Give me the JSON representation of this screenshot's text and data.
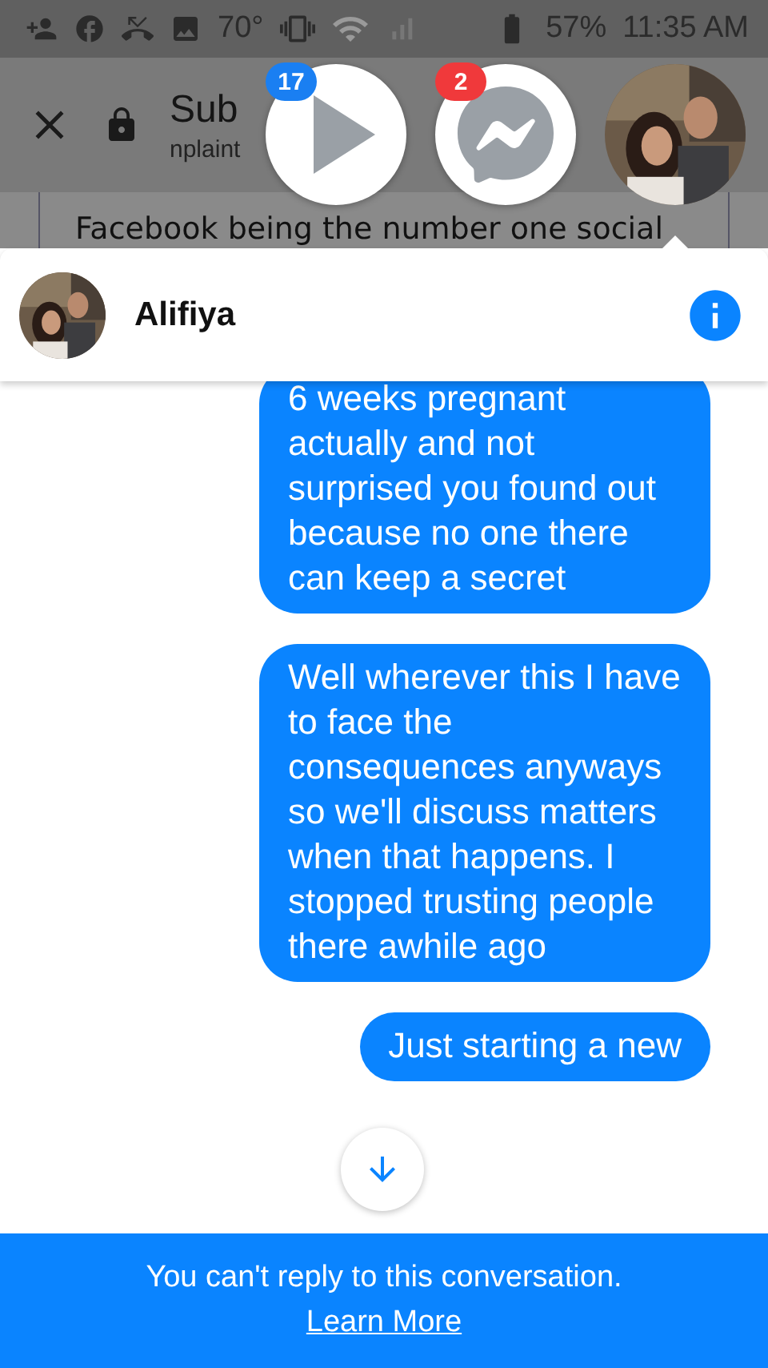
{
  "status_bar": {
    "temperature": "70°",
    "battery": "57%",
    "time": "11:35 AM"
  },
  "browser": {
    "title": "Sub",
    "url": "nplaint"
  },
  "page_text": "Facebook being the number one social",
  "chat_heads": [
    {
      "kind": "video",
      "badge": "17",
      "color": "#1a7ff2"
    },
    {
      "kind": "messenger",
      "badge": "2",
      "color": "#f0393b"
    },
    {
      "kind": "avatar"
    }
  ],
  "conversation": {
    "name": "Alifiya"
  },
  "messages": [
    {
      "text": "6 weeks pregnant actually and not surprised you found out because no one there can keep a secret"
    },
    {
      "text": "Well wherever this I have to face the consequences anyways so we'll discuss matters when that happens. I stopped trusting people there awhile ago"
    },
    {
      "text": "Just starting a new"
    }
  ],
  "notice": {
    "text": "You can't reply to this conversation.",
    "link": "Learn More"
  }
}
